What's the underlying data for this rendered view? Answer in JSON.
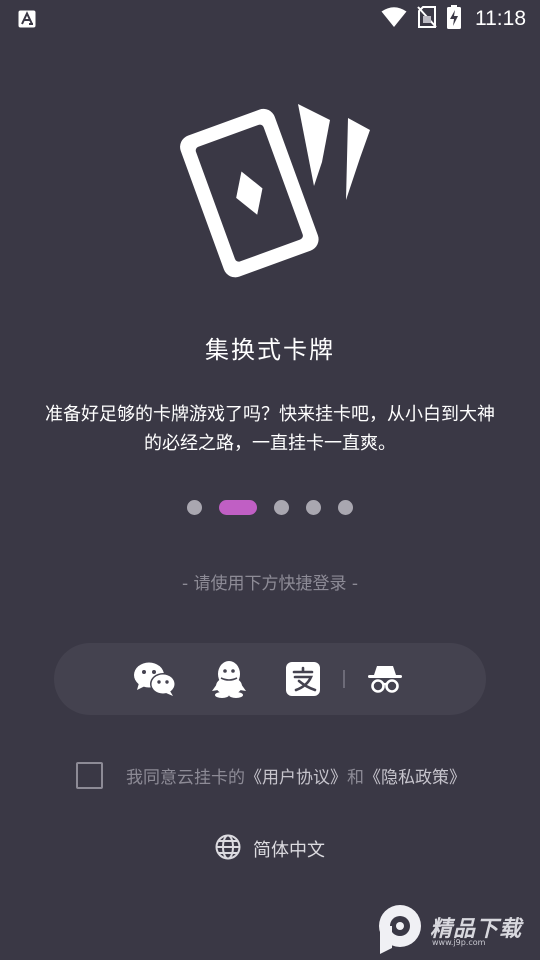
{
  "status_bar": {
    "time": "11:18",
    "icons": [
      "app-notification-icon",
      "wifi-icon",
      "no-sim-icon",
      "battery-charging-icon"
    ]
  },
  "hero": {
    "icon": "playing-cards-icon"
  },
  "title": "集换式卡牌",
  "description": "准备好足够的卡牌游戏了吗？快来挂卡吧，从小白到大神的必经之路，一直挂卡一直爽。",
  "pager": {
    "count": 5,
    "active_index": 1,
    "active_color": "#c05fc4",
    "inactive_color": "#a9a7b0"
  },
  "login_hint": "- 请使用下方快捷登录 -",
  "login_options": [
    {
      "icon": "wechat-icon"
    },
    {
      "icon": "qq-icon"
    },
    {
      "icon": "alipay-icon"
    },
    {
      "icon": "incognito-guest-icon"
    }
  ],
  "agreement": {
    "checked": false,
    "prefix": "我同意云挂卡的",
    "user_agreement": "《用户协议》",
    "conjunction": "和",
    "privacy_policy": "《隐私政策》"
  },
  "language": {
    "icon": "globe-icon",
    "label": "简体中文"
  },
  "watermark": {
    "brand": "精品下载",
    "url": "www.j9p.com"
  },
  "colors": {
    "background": "#3a3845",
    "panel": "#44424f",
    "accent": "#c05fc4",
    "muted_text": "#8d8b96"
  }
}
